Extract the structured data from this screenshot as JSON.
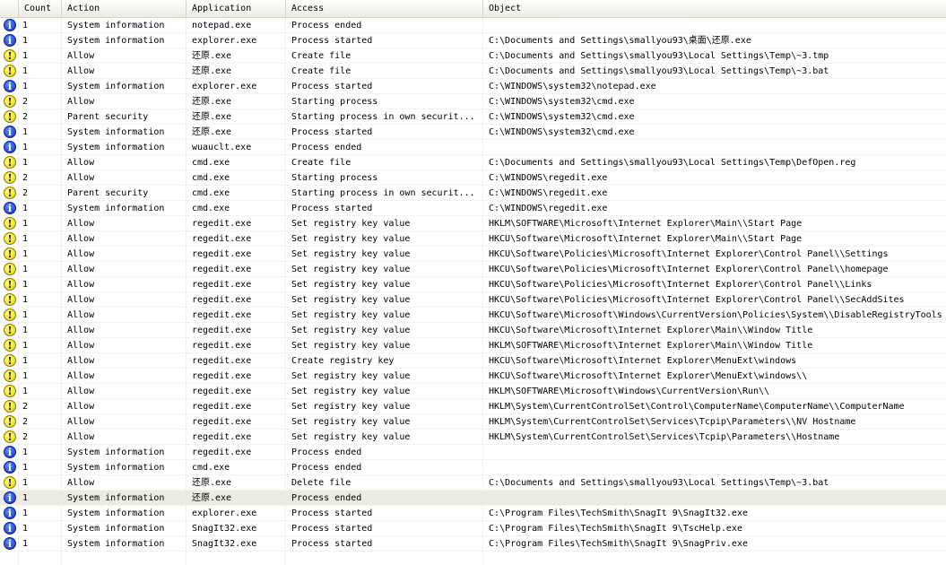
{
  "columns": {
    "icon": "",
    "count": "Count",
    "action": "Action",
    "application": "Application",
    "access": "Access",
    "object": "Object"
  },
  "colors": {
    "info": "#1a3fd6",
    "warn": "#f0dc00",
    "selected_row": "#ecebe2"
  },
  "rows": [
    {
      "icon": "info",
      "count": "1",
      "action": "System information",
      "app": "notepad.exe",
      "access": "Process ended",
      "object": ""
    },
    {
      "icon": "info",
      "count": "1",
      "action": "System information",
      "app": "explorer.exe",
      "access": "Process started",
      "object": "C:\\Documents and Settings\\smallyou93\\桌面\\还原.exe"
    },
    {
      "icon": "warn",
      "count": "1",
      "action": "Allow",
      "app": "还原.exe",
      "access": "Create file",
      "object": "C:\\Documents and Settings\\smallyou93\\Local Settings\\Temp\\~3.tmp"
    },
    {
      "icon": "warn",
      "count": "1",
      "action": "Allow",
      "app": "还原.exe",
      "access": "Create file",
      "object": "C:\\Documents and Settings\\smallyou93\\Local Settings\\Temp\\~3.bat"
    },
    {
      "icon": "info",
      "count": "1",
      "action": "System information",
      "app": "explorer.exe",
      "access": "Process started",
      "object": "C:\\WINDOWS\\system32\\notepad.exe"
    },
    {
      "icon": "warn",
      "count": "2",
      "action": "Allow",
      "app": "还原.exe",
      "access": "Starting process",
      "object": "C:\\WINDOWS\\system32\\cmd.exe"
    },
    {
      "icon": "warn",
      "count": "2",
      "action": "Parent security",
      "app": "还原.exe",
      "access": "Starting process in own securit...",
      "object": "C:\\WINDOWS\\system32\\cmd.exe"
    },
    {
      "icon": "info",
      "count": "1",
      "action": "System information",
      "app": "还原.exe",
      "access": "Process started",
      "object": "C:\\WINDOWS\\system32\\cmd.exe"
    },
    {
      "icon": "info",
      "count": "1",
      "action": "System information",
      "app": "wuauclt.exe",
      "access": "Process ended",
      "object": ""
    },
    {
      "icon": "warn",
      "count": "1",
      "action": "Allow",
      "app": "cmd.exe",
      "access": "Create file",
      "object": "C:\\Documents and Settings\\smallyou93\\Local Settings\\Temp\\DefOpen.reg"
    },
    {
      "icon": "warn",
      "count": "2",
      "action": "Allow",
      "app": "cmd.exe",
      "access": "Starting process",
      "object": "C:\\WINDOWS\\regedit.exe"
    },
    {
      "icon": "warn",
      "count": "2",
      "action": "Parent security",
      "app": "cmd.exe",
      "access": "Starting process in own securit...",
      "object": "C:\\WINDOWS\\regedit.exe"
    },
    {
      "icon": "info",
      "count": "1",
      "action": "System information",
      "app": "cmd.exe",
      "access": "Process started",
      "object": "C:\\WINDOWS\\regedit.exe"
    },
    {
      "icon": "warn",
      "count": "1",
      "action": "Allow",
      "app": "regedit.exe",
      "access": "Set registry key value",
      "object": "HKLM\\SOFTWARE\\Microsoft\\Internet Explorer\\Main\\\\Start Page"
    },
    {
      "icon": "warn",
      "count": "1",
      "action": "Allow",
      "app": "regedit.exe",
      "access": "Set registry key value",
      "object": "HKCU\\Software\\Microsoft\\Internet Explorer\\Main\\\\Start Page"
    },
    {
      "icon": "warn",
      "count": "1",
      "action": "Allow",
      "app": "regedit.exe",
      "access": "Set registry key value",
      "object": "HKCU\\Software\\Policies\\Microsoft\\Internet Explorer\\Control Panel\\\\Settings"
    },
    {
      "icon": "warn",
      "count": "1",
      "action": "Allow",
      "app": "regedit.exe",
      "access": "Set registry key value",
      "object": "HKCU\\Software\\Policies\\Microsoft\\Internet Explorer\\Control Panel\\\\homepage"
    },
    {
      "icon": "warn",
      "count": "1",
      "action": "Allow",
      "app": "regedit.exe",
      "access": "Set registry key value",
      "object": "HKCU\\Software\\Policies\\Microsoft\\Internet Explorer\\Control Panel\\\\Links"
    },
    {
      "icon": "warn",
      "count": "1",
      "action": "Allow",
      "app": "regedit.exe",
      "access": "Set registry key value",
      "object": "HKCU\\Software\\Policies\\Microsoft\\Internet Explorer\\Control Panel\\\\SecAddSites"
    },
    {
      "icon": "warn",
      "count": "1",
      "action": "Allow",
      "app": "regedit.exe",
      "access": "Set registry key value",
      "object": "HKCU\\Software\\Microsoft\\Windows\\CurrentVersion\\Policies\\System\\\\DisableRegistryTools"
    },
    {
      "icon": "warn",
      "count": "1",
      "action": "Allow",
      "app": "regedit.exe",
      "access": "Set registry key value",
      "object": "HKCU\\Software\\Microsoft\\Internet Explorer\\Main\\\\Window Title"
    },
    {
      "icon": "warn",
      "count": "1",
      "action": "Allow",
      "app": "regedit.exe",
      "access": "Set registry key value",
      "object": "HKLM\\SOFTWARE\\Microsoft\\Internet Explorer\\Main\\\\Window Title"
    },
    {
      "icon": "warn",
      "count": "1",
      "action": "Allow",
      "app": "regedit.exe",
      "access": "Create registry key",
      "object": "HKCU\\Software\\Microsoft\\Internet Explorer\\MenuExt\\windows"
    },
    {
      "icon": "warn",
      "count": "1",
      "action": "Allow",
      "app": "regedit.exe",
      "access": "Set registry key value",
      "object": "HKCU\\Software\\Microsoft\\Internet Explorer\\MenuExt\\windows\\\\"
    },
    {
      "icon": "warn",
      "count": "1",
      "action": "Allow",
      "app": "regedit.exe",
      "access": "Set registry key value",
      "object": "HKLM\\SOFTWARE\\Microsoft\\Windows\\CurrentVersion\\Run\\\\"
    },
    {
      "icon": "warn",
      "count": "2",
      "action": "Allow",
      "app": "regedit.exe",
      "access": "Set registry key value",
      "object": "HKLM\\System\\CurrentControlSet\\Control\\ComputerName\\ComputerName\\\\ComputerName"
    },
    {
      "icon": "warn",
      "count": "2",
      "action": "Allow",
      "app": "regedit.exe",
      "access": "Set registry key value",
      "object": "HKLM\\System\\CurrentControlSet\\Services\\Tcpip\\Parameters\\\\NV Hostname"
    },
    {
      "icon": "warn",
      "count": "2",
      "action": "Allow",
      "app": "regedit.exe",
      "access": "Set registry key value",
      "object": "HKLM\\System\\CurrentControlSet\\Services\\Tcpip\\Parameters\\\\Hostname"
    },
    {
      "icon": "info",
      "count": "1",
      "action": "System information",
      "app": "regedit.exe",
      "access": "Process ended",
      "object": ""
    },
    {
      "icon": "info",
      "count": "1",
      "action": "System information",
      "app": "cmd.exe",
      "access": "Process ended",
      "object": ""
    },
    {
      "icon": "warn",
      "count": "1",
      "action": "Allow",
      "app": "还原.exe",
      "access": "Delete file",
      "object": "C:\\Documents and Settings\\smallyou93\\Local Settings\\Temp\\~3.bat"
    },
    {
      "icon": "info",
      "count": "1",
      "action": "System information",
      "app": "还原.exe",
      "access": "Process ended",
      "object": "",
      "selected": true
    },
    {
      "icon": "info",
      "count": "1",
      "action": "System information",
      "app": "explorer.exe",
      "access": "Process started",
      "object": "C:\\Program Files\\TechSmith\\SnagIt 9\\SnagIt32.exe"
    },
    {
      "icon": "info",
      "count": "1",
      "action": "System information",
      "app": "SnagIt32.exe",
      "access": "Process started",
      "object": "C:\\Program Files\\TechSmith\\SnagIt 9\\TscHelp.exe"
    },
    {
      "icon": "info",
      "count": "1",
      "action": "System information",
      "app": "SnagIt32.exe",
      "access": "Process started",
      "object": "C:\\Program Files\\TechSmith\\SnagIt 9\\SnagPriv.exe"
    }
  ]
}
